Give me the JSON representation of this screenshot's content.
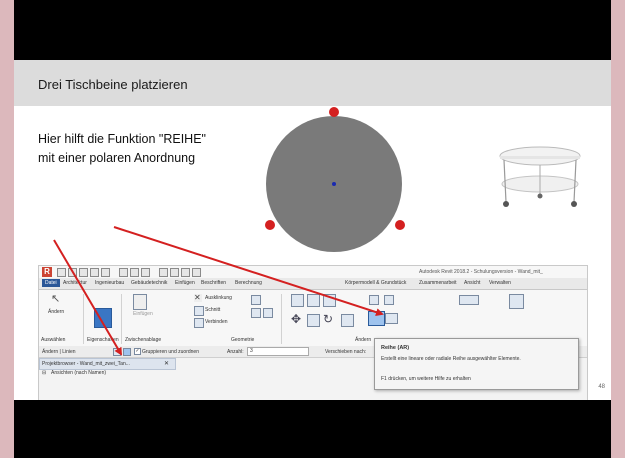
{
  "slide": {
    "title": "Drei Tischbeine platzieren",
    "hint_line1": "Hier hilft die Funktion \"REIHE\"",
    "hint_line2": "mit einer polaren Anordnung",
    "page_number": "48"
  },
  "revit": {
    "window_title": "Autodesk Revit 2018.2 - Schulungsversion - Wand_mit_",
    "tabs": [
      "Datei",
      "Architektur",
      "Ingenieurbau",
      "Gebäudetechnik",
      "Einfügen",
      "Beschriften",
      "Berechnung",
      "Körpermodell & Grundstück",
      "Zusammenarbeit",
      "Ansicht",
      "Verwalten"
    ],
    "ribbon": {
      "modify_label": "Ändern",
      "panel_select": "Auswählen",
      "panel_properties": "Eigenschaften",
      "panel_clipboard": "Zwischenablage",
      "panel_geometry": "Geometrie",
      "panel_modify": "Ändern",
      "insert_label": "Einfügen",
      "cmd_cut": "Ausklinkung",
      "cmd_cut_geometry": "Schnitt",
      "cmd_join": "Verbinden"
    },
    "options_bar": {
      "context": "Ändern | Linien",
      "group_checkbox": "Gruppieren und zuordnen",
      "count_label": "Anzahl:",
      "count_value": "3",
      "move_label": "Verschieben nach:"
    },
    "project_browser": {
      "title": "Projektbrowser - Wand_mit_zwei_Tan...",
      "item": "Ansichten (nach Namen)"
    },
    "tooltip": {
      "title": "Reihe (AR)",
      "desc": "Erstellt eine lineare oder radiale Reihe ausgewählter Elemente.",
      "help": "F1 drücken, um weitere Hilfe zu erhalten"
    }
  },
  "colors": {
    "leg_marker": "#d42020",
    "circle": "#7a7a7a",
    "arrow": "#d42020",
    "center": "#1a2ab0"
  }
}
